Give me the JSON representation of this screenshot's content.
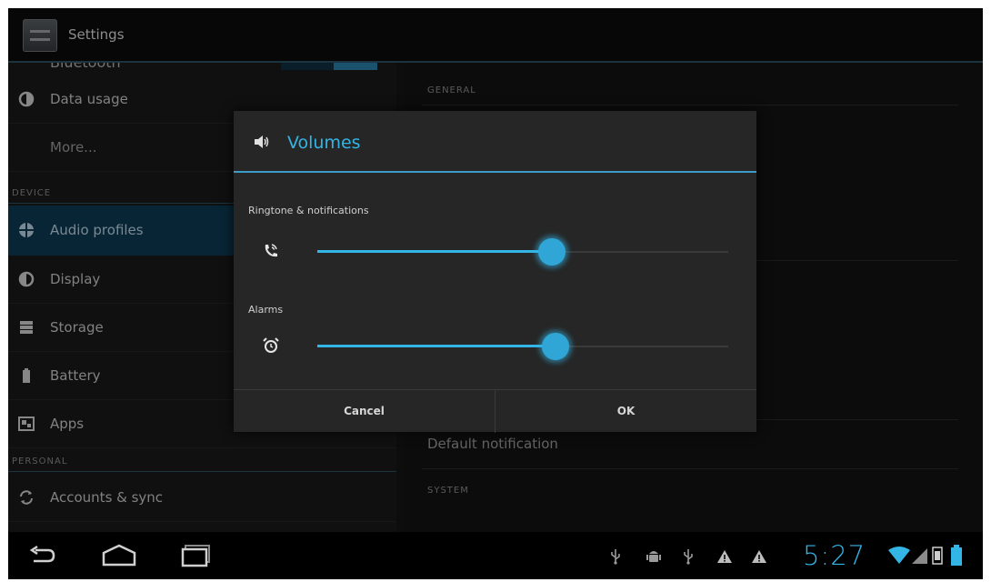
{
  "action_bar": {
    "title": "Settings",
    "app_icon": "settings-app-icon"
  },
  "left_pane": {
    "partial_item": "Bluetooth",
    "items_wireless": [
      {
        "label": "Data usage",
        "icon": "data-usage-icon"
      },
      {
        "label": "More...",
        "icon": ""
      }
    ],
    "section_device": "DEVICE",
    "items_device": [
      {
        "label": "Audio profiles",
        "icon": "audio-profiles-icon",
        "selected": true
      },
      {
        "label": "Display",
        "icon": "display-icon"
      },
      {
        "label": "Storage",
        "icon": "storage-icon"
      },
      {
        "label": "Battery",
        "icon": "battery-icon"
      },
      {
        "label": "Apps",
        "icon": "apps-icon"
      }
    ],
    "section_personal": "PERSONAL",
    "items_personal": [
      {
        "label": "Accounts & sync",
        "icon": "sync-icon"
      }
    ]
  },
  "right_pane": {
    "section_general": "GENERAL",
    "default_notification": "Default notification",
    "section_system": "SYSTEM"
  },
  "dialog": {
    "title": "Volumes",
    "title_icon": "speaker-icon",
    "ringtone_label": "Ringtone & notifications",
    "ringtone_icon": "phone-ring-icon",
    "ringtone_level": 0.57,
    "alarms_label": "Alarms",
    "alarms_icon": "alarm-clock-icon",
    "alarms_level": 0.58,
    "cancel_label": "Cancel",
    "ok_label": "OK"
  },
  "nav_bar": {
    "back_icon": "back-icon",
    "home_icon": "home-icon",
    "recents_icon": "recent-apps-icon",
    "status_icons": [
      "usb-icon",
      "android-debug-icon",
      "usb-icon",
      "warning-icon",
      "warning-icon"
    ],
    "clock": "5:27",
    "wifi_icon": "wifi-icon",
    "signal_icon": "signal-icon",
    "battery_icon": "battery-status-icon"
  },
  "colors": {
    "accent": "#33b5e5",
    "selected_row": "#0d3a52",
    "dialog_bg": "#262626",
    "background": "#151515"
  }
}
